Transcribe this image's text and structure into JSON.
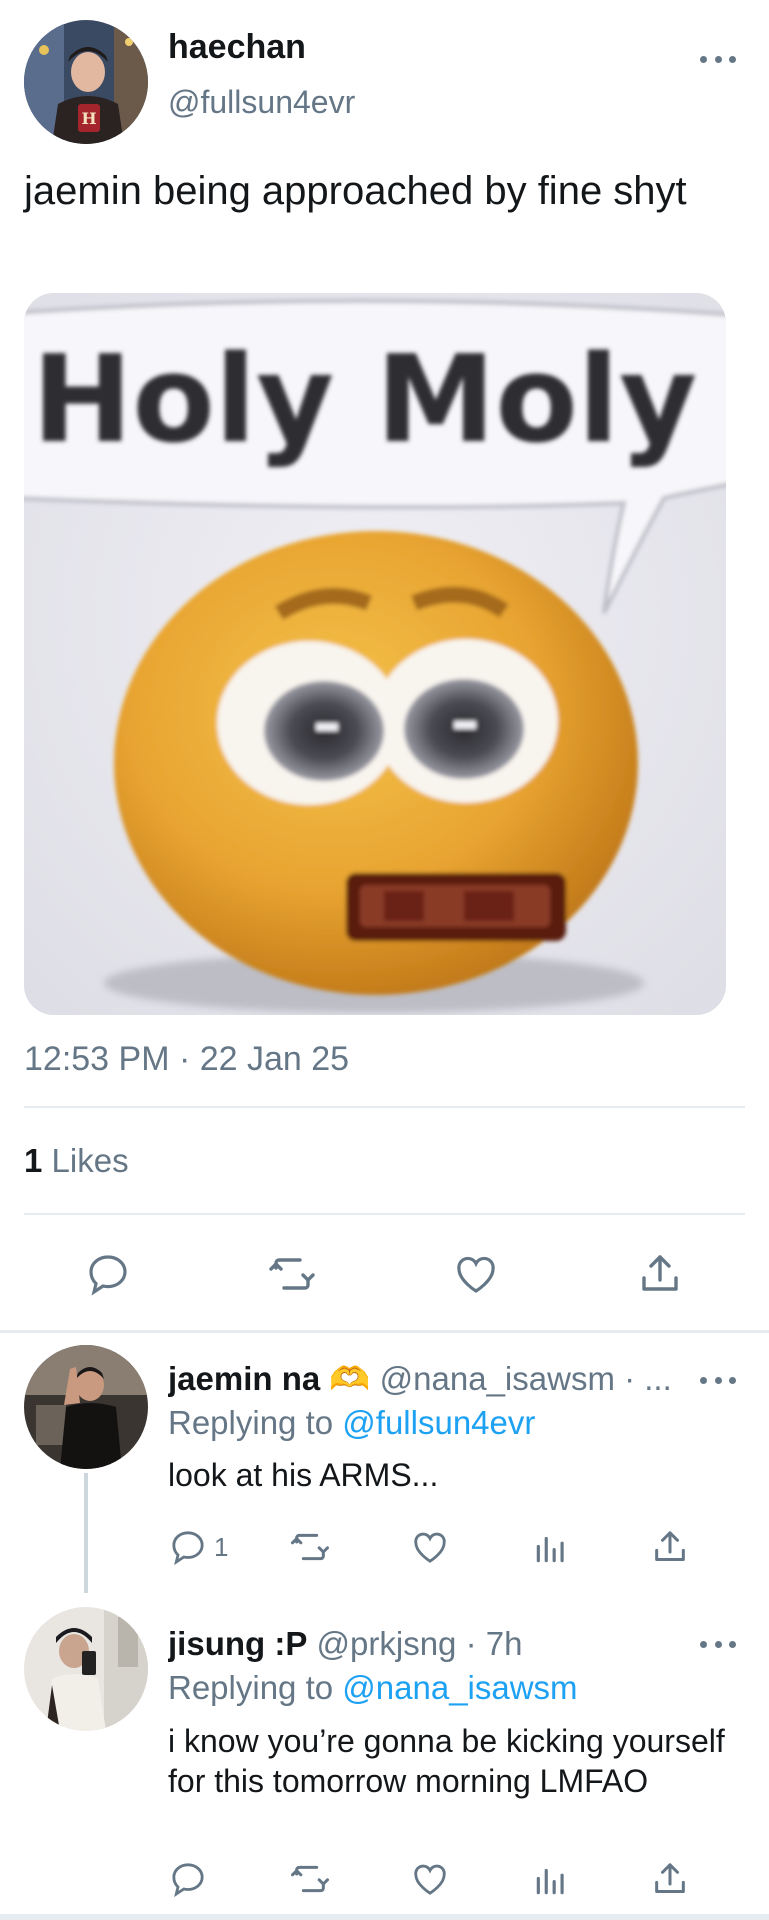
{
  "main_tweet": {
    "display_name": "haechan",
    "handle": "@fullsun4evr",
    "text": "jaemin being approached by fine shyt",
    "media": {
      "caption_text": "Holy Moly"
    },
    "timestamp": "12:53 PM · 22 Jan 25",
    "likes_count": "1",
    "likes_label": "Likes",
    "actions": [
      "reply-icon",
      "retweet-icon",
      "like-icon",
      "share-icon"
    ]
  },
  "replies": [
    {
      "display_name": "jaemin na",
      "name_emoji": "🫶",
      "meta": "@nana_isawsm · ...",
      "replying_prefix": "Replying to",
      "replying_to": "@fullsun4evr",
      "text": "look at his ARMS...",
      "reply_count": "1"
    },
    {
      "display_name": "jisung :P",
      "meta": "@prkjsng · 7h",
      "replying_prefix": "Replying to",
      "replying_to": "@nana_isawsm",
      "text": "i know you’re gonna be kicking yourself for this tomorrow morning LMFAO",
      "reply_count": ""
    }
  ],
  "colors": {
    "text_primary": "#14171a",
    "text_secondary": "#657786",
    "link_blue": "#1da1f2",
    "divider": "#e6ecf0"
  }
}
